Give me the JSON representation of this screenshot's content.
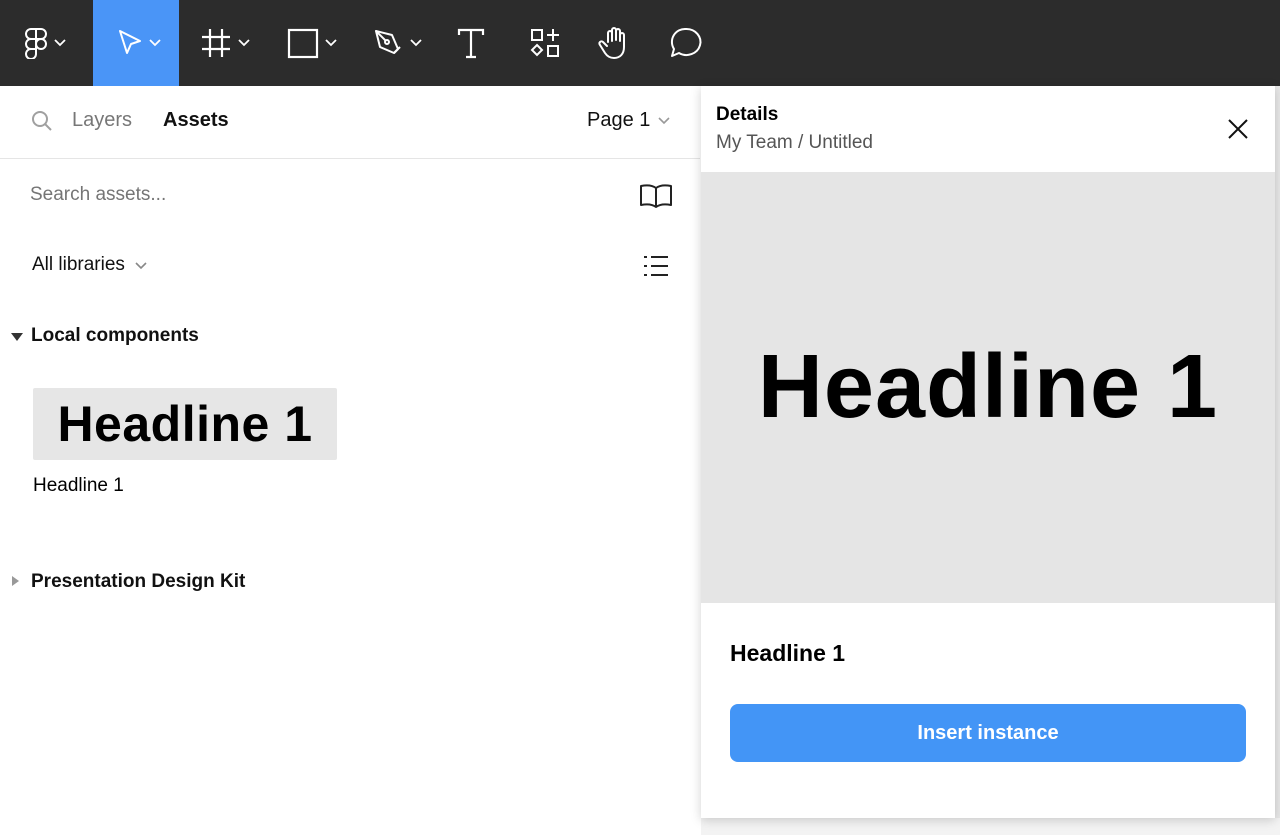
{
  "toolbar": {
    "tools": [
      {
        "name": "main-menu",
        "icon": "figma-logo-icon",
        "has_dropdown": true
      },
      {
        "name": "move-tool",
        "icon": "cursor-arrow-icon",
        "has_dropdown": true,
        "active": true
      },
      {
        "name": "frame-tool",
        "icon": "frame-hash-icon",
        "has_dropdown": true
      },
      {
        "name": "shape-tool",
        "icon": "rectangle-icon",
        "has_dropdown": true
      },
      {
        "name": "pen-tool",
        "icon": "pen-nib-icon",
        "has_dropdown": true
      },
      {
        "name": "text-tool",
        "icon": "text-t-icon",
        "has_dropdown": false
      },
      {
        "name": "resources-tool",
        "icon": "components-shapes-icon",
        "has_dropdown": false
      },
      {
        "name": "hand-tool",
        "icon": "hand-icon",
        "has_dropdown": false
      },
      {
        "name": "comment-tool",
        "icon": "speech-bubble-icon",
        "has_dropdown": false
      }
    ],
    "active_color": "#4a95f7",
    "background": "#2c2c2c"
  },
  "left_panel": {
    "tabs": {
      "layers_label": "Layers",
      "assets_label": "Assets",
      "active": "Assets"
    },
    "page_selector": "Page 1",
    "search": {
      "placeholder": "Search assets..."
    },
    "library_filter": "All libraries",
    "sections": [
      {
        "title": "Local components",
        "expanded": true,
        "components": [
          {
            "preview_text": "Headline 1",
            "label": "Headline 1"
          }
        ]
      },
      {
        "title": "Presentation Design Kit",
        "expanded": false
      }
    ]
  },
  "details_panel": {
    "title": "Details",
    "path": "My Team / Untitled",
    "preview_text": "Headline 1",
    "component_name": "Headline 1",
    "insert_label": "Insert instance",
    "insert_color": "#4395f6"
  }
}
